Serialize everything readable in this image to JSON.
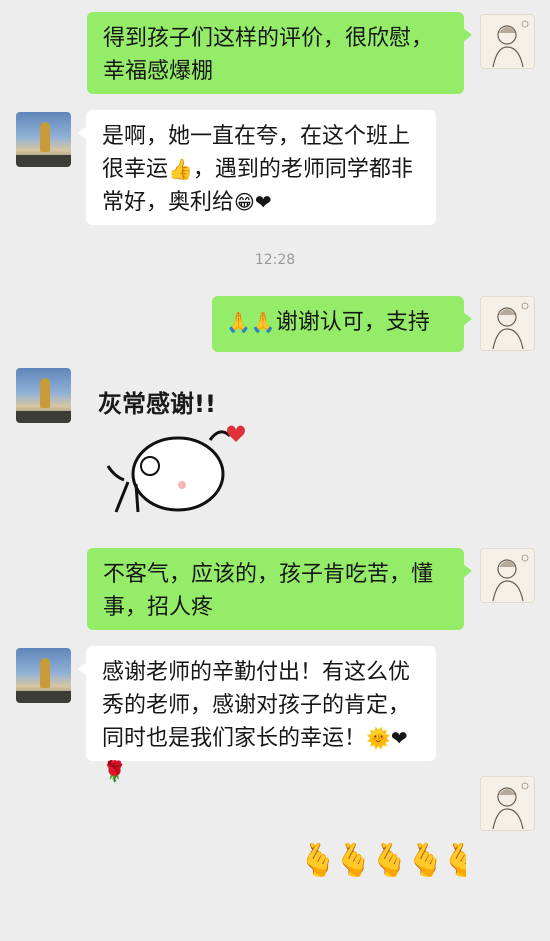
{
  "messages": [
    {
      "side": "right",
      "text": "得到孩子们这样的评价，很欣慰，幸福感爆棚"
    },
    {
      "side": "left",
      "text": "是啊，她一直在夸，在这个班上很幸运",
      "emoji1": "👍",
      "text2": "，遇到的老师同学都非常好，奥利给",
      "emoji2": "😁❤"
    },
    {
      "side": "right",
      "emoji": "🙏🙏",
      "text": "谢谢认可，支持"
    },
    {
      "side": "left",
      "sticker_text": "灰常感谢!!"
    },
    {
      "side": "right",
      "text": "不客气，应该的，孩子肯吃苦，懂事，招人疼"
    },
    {
      "side": "left",
      "text": "感谢老师的辛勤付出！有这么优秀的老师，感谢对孩子的肯定，同时也是我们家长的幸运！",
      "emoji": "🌞❤🌹"
    },
    {
      "side": "right",
      "sticker_text": "🫰🫰🫰🫰🫰"
    }
  ],
  "timestamp": "12:28",
  "colors": {
    "background": "#ededed",
    "right_bubble": "#95ec69",
    "left_bubble": "#ffffff"
  }
}
